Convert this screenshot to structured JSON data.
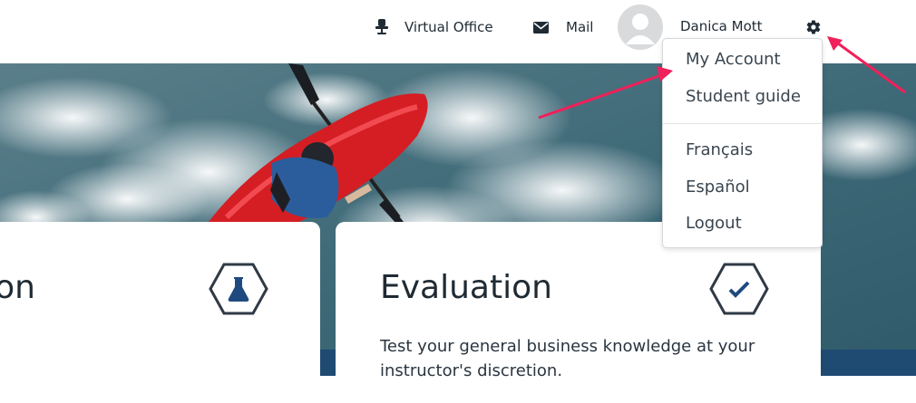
{
  "header": {
    "virtual_office_label": "Virtual Office",
    "virtual_office_icon": "office-chair-icon",
    "mail_label": "Mail",
    "mail_icon": "envelope-icon",
    "user_name": "Danica Mott",
    "settings_icon": "gear-icon"
  },
  "menu": {
    "items": [
      {
        "label": "My Account"
      },
      {
        "label": "Student guide"
      },
      {
        "label": "Français"
      },
      {
        "label": "Español"
      },
      {
        "label": "Logout"
      }
    ]
  },
  "cards": [
    {
      "title": "on",
      "icon": "flask-icon"
    },
    {
      "title": "Evaluation",
      "icon": "checkmark-icon",
      "description": "Test your general business knowledge at your instructor's discretion."
    }
  ],
  "colors": {
    "accent_arrow": "#f0205a",
    "hex_outline": "#2f3a45",
    "icon_blue": "#1f4a80",
    "banner_blue": "#1f4a72"
  }
}
